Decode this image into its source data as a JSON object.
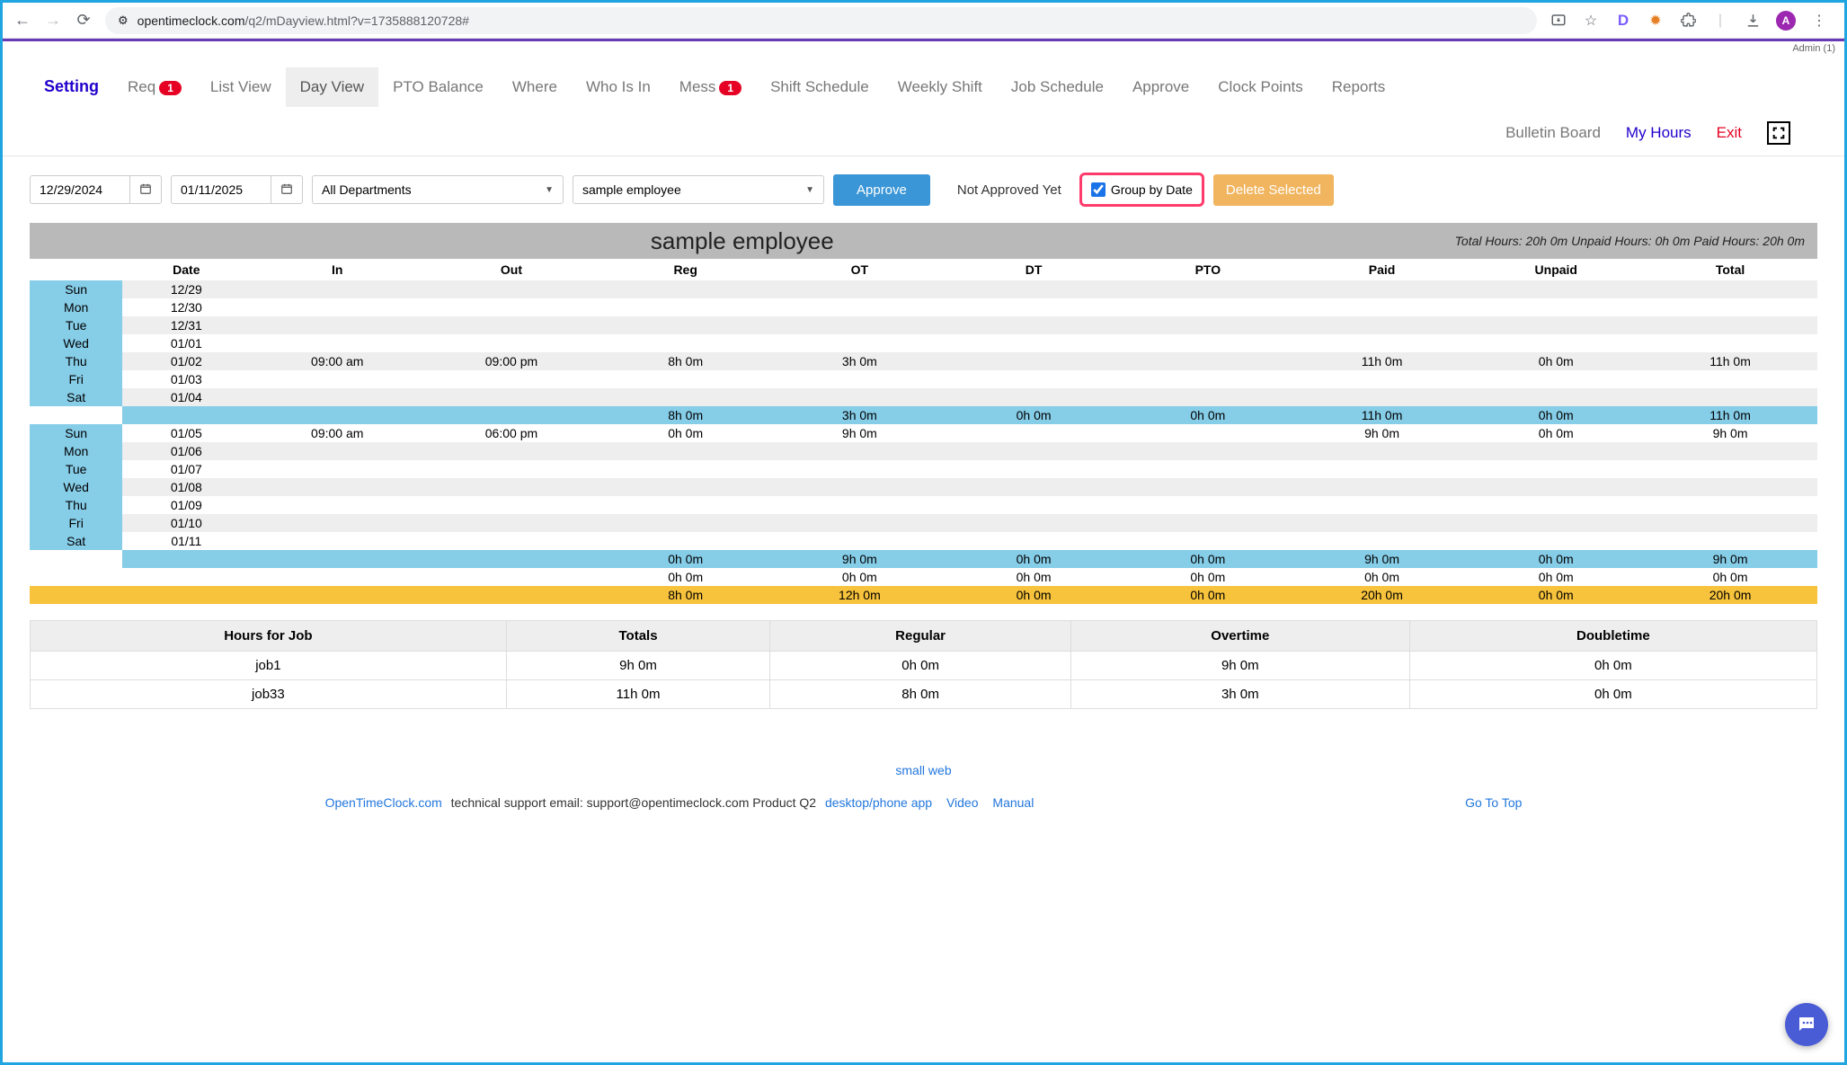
{
  "browser": {
    "url_host": "opentimeclock.com",
    "url_path": "/q2/mDayview.html?v=1735888120728#",
    "admin_label": "Admin (1)",
    "avatar_letter": "A",
    "ext_d": "D"
  },
  "tabs": {
    "setting": "Setting",
    "req": "Req",
    "req_badge": "1",
    "list_view": "List View",
    "day_view": "Day View",
    "pto_balance": "PTO Balance",
    "where": "Where",
    "who_is_in": "Who Is In",
    "mess": "Mess",
    "mess_badge": "1",
    "shift_schedule": "Shift Schedule",
    "weekly_shift": "Weekly Shift",
    "job_schedule": "Job Schedule",
    "approve": "Approve",
    "clock_points": "Clock Points",
    "reports": "Reports",
    "bulletin": "Bulletin Board",
    "my_hours": "My Hours",
    "exit": "Exit"
  },
  "toolbar": {
    "date_from": "12/29/2024",
    "date_to": "01/11/2025",
    "dept": "All Departments",
    "employee": "sample employee",
    "approve_btn": "Approve",
    "not_approved": "Not Approved Yet",
    "group_label": "Group by Date",
    "delete_btn": "Delete Selected"
  },
  "header": {
    "employee_name": "sample employee",
    "totals": "Total Hours: 20h 0m Unpaid Hours: 0h 0m Paid Hours: 20h 0m",
    "cols": [
      "Date",
      "In",
      "Out",
      "Reg",
      "OT",
      "DT",
      "PTO",
      "Paid",
      "Unpaid",
      "Total"
    ]
  },
  "rows": [
    {
      "day": "Sun",
      "date": "12/29"
    },
    {
      "day": "Mon",
      "date": "12/30"
    },
    {
      "day": "Tue",
      "date": "12/31"
    },
    {
      "day": "Wed",
      "date": "01/01"
    },
    {
      "day": "Thu",
      "date": "01/02",
      "in": "09:00 am",
      "out": "09:00 pm",
      "reg": "8h 0m",
      "ot": "3h 0m",
      "paid": "11h 0m",
      "unpaid": "0h 0m",
      "total": "11h 0m"
    },
    {
      "day": "Fri",
      "date": "01/03"
    },
    {
      "day": "Sat",
      "date": "01/04"
    }
  ],
  "week1_sum": {
    "reg": "8h 0m",
    "ot": "3h 0m",
    "dt": "0h 0m",
    "pto": "0h 0m",
    "paid": "11h 0m",
    "unpaid": "0h 0m",
    "total": "11h 0m"
  },
  "rows2": [
    {
      "day": "Sun",
      "date": "01/05",
      "in": "09:00 am",
      "out": "06:00 pm",
      "reg": "0h 0m",
      "ot": "9h 0m",
      "paid": "9h 0m",
      "unpaid": "0h 0m",
      "total": "9h 0m"
    },
    {
      "day": "Mon",
      "date": "01/06"
    },
    {
      "day": "Tue",
      "date": "01/07"
    },
    {
      "day": "Wed",
      "date": "01/08"
    },
    {
      "day": "Thu",
      "date": "01/09"
    },
    {
      "day": "Fri",
      "date": "01/10"
    },
    {
      "day": "Sat",
      "date": "01/11"
    }
  ],
  "week2_sum": {
    "reg": "0h 0m",
    "ot": "9h 0m",
    "dt": "0h 0m",
    "pto": "0h 0m",
    "paid": "9h 0m",
    "unpaid": "0h 0m",
    "total": "9h 0m"
  },
  "zero_row": {
    "reg": "0h 0m",
    "ot": "0h 0m",
    "dt": "0h 0m",
    "pto": "0h 0m",
    "paid": "0h 0m",
    "unpaid": "0h 0m",
    "total": "0h 0m"
  },
  "grand": {
    "reg": "8h 0m",
    "ot": "12h 0m",
    "dt": "0h 0m",
    "pto": "0h 0m",
    "paid": "20h 0m",
    "unpaid": "0h 0m",
    "total": "20h 0m"
  },
  "jobs": {
    "headers": [
      "Hours for Job",
      "Totals",
      "Regular",
      "Overtime",
      "Doubletime"
    ],
    "rows": [
      {
        "name": "job1",
        "totals": "9h 0m",
        "reg": "0h 0m",
        "ot": "9h 0m",
        "dt": "0h 0m"
      },
      {
        "name": "job33",
        "totals": "11h 0m",
        "reg": "8h 0m",
        "ot": "3h 0m",
        "dt": "0h 0m"
      }
    ]
  },
  "footer": {
    "small_web": "small web",
    "otc_link": "OpenTimeClock.com",
    "support_text": " technical support email: support@opentimeclock.com Product Q2   ",
    "desktop": "desktop/phone app",
    "video": "Video",
    "manual": "Manual",
    "gotop": "Go To Top"
  }
}
